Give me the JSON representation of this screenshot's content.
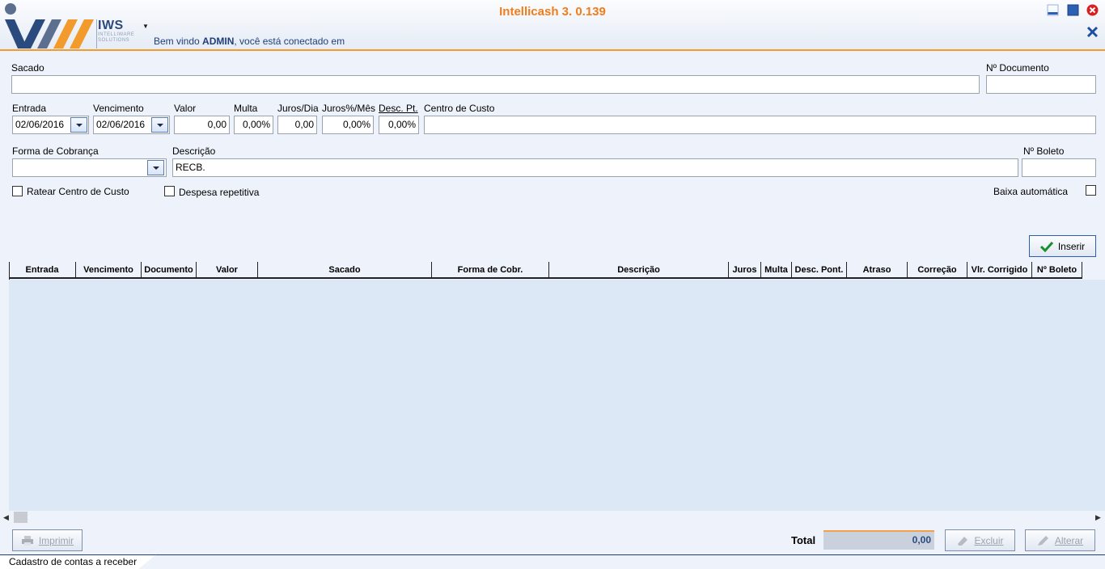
{
  "app": {
    "title": "Intellicash 3. 0.139",
    "logo_text": "IWS",
    "logo_sub1": "INTELLIWARE",
    "logo_sub2": "SOLUTIONS",
    "welcome_prefix": "Bem vindo ",
    "welcome_user": "ADMIN",
    "welcome_suffix": ", você está conectado em"
  },
  "form": {
    "sacado": {
      "label": "Sacado",
      "value": ""
    },
    "documento": {
      "label": "Nº Documento",
      "value": ""
    },
    "entrada": {
      "label": "Entrada",
      "value": "02/06/2016"
    },
    "vencimento": {
      "label": "Vencimento",
      "value": "02/06/2016"
    },
    "valor": {
      "label": "Valor",
      "value": "0,00"
    },
    "multa": {
      "label": "Multa",
      "value": "0,00%"
    },
    "juros_dia": {
      "label": "Juros/Dia",
      "value": "0,00"
    },
    "juros_mes": {
      "label": "Juros%/Mês",
      "value": "0,00%"
    },
    "desc_pt": {
      "label": "Desc. Pt.",
      "value": "0,00%"
    },
    "centro_custo": {
      "label": "Centro de Custo",
      "value": ""
    },
    "forma_cobranca": {
      "label": "Forma de Cobrança",
      "value": ""
    },
    "descricao": {
      "label": "Descrição",
      "value": "RECB."
    },
    "boleto": {
      "label": "Nº Boleto",
      "value": ""
    },
    "ratear": {
      "label": "Ratear Centro de Custo",
      "checked": false
    },
    "despesa": {
      "label": "Despesa repetitiva",
      "checked": false
    },
    "baixa": {
      "label": "Baixa automática",
      "checked": false
    }
  },
  "buttons": {
    "inserir": "Inserir",
    "imprimir": "Imprimir",
    "excluir": "Excluir",
    "alterar": "Alterar"
  },
  "grid": {
    "columns": [
      "Entrada",
      "Vencimento",
      "Documento",
      "Valor",
      "Sacado",
      "Forma de Cobr.",
      "Descrição",
      "Juros",
      "Multa",
      "Desc. Pont.",
      "Atraso",
      "Correção",
      "Vlr. Corrigido",
      "Nº Boleto"
    ],
    "rows": []
  },
  "footer": {
    "total_label": "Total",
    "total_value": "0,00"
  },
  "tab": {
    "label": "Cadastro de contas a receber"
  },
  "colors": {
    "accent": "#f07d1a",
    "brand": "#1f3e7a",
    "grid_bg": "#dde8f7"
  }
}
